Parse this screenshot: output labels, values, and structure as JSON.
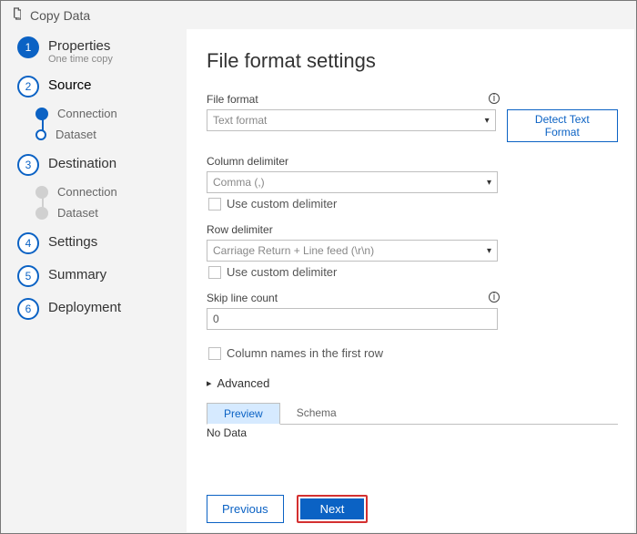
{
  "titlebar": {
    "label": "Copy Data"
  },
  "wizard": {
    "steps": [
      {
        "num": "1",
        "label": "Properties",
        "sub": "One time copy"
      },
      {
        "num": "2",
        "label": "Source",
        "substeps": [
          {
            "label": "Connection",
            "state": "filled"
          },
          {
            "label": "Dataset",
            "state": "ring"
          }
        ]
      },
      {
        "num": "3",
        "label": "Destination",
        "substeps": [
          {
            "label": "Connection",
            "state": "gray"
          },
          {
            "label": "Dataset",
            "state": "gray"
          }
        ]
      },
      {
        "num": "4",
        "label": "Settings"
      },
      {
        "num": "5",
        "label": "Summary"
      },
      {
        "num": "6",
        "label": "Deployment"
      }
    ]
  },
  "page": {
    "title": "File format settings",
    "file_format": {
      "label": "File format",
      "value": "Text format"
    },
    "detect_btn": "Detect Text Format",
    "col_delim": {
      "label": "Column delimiter",
      "value": "Comma (,)",
      "custom_label": "Use custom delimiter"
    },
    "row_delim": {
      "label": "Row delimiter",
      "value": "Carriage Return + Line feed (\\r\\n)",
      "custom_label": "Use custom delimiter"
    },
    "skip_lines": {
      "label": "Skip line count",
      "value": "0"
    },
    "col_names_first_row": "Column names in the first row",
    "advanced": "Advanced",
    "tabs": {
      "preview": "Preview",
      "schema": "Schema"
    },
    "preview_text": "No Data",
    "footer": {
      "previous": "Previous",
      "next": "Next"
    }
  }
}
